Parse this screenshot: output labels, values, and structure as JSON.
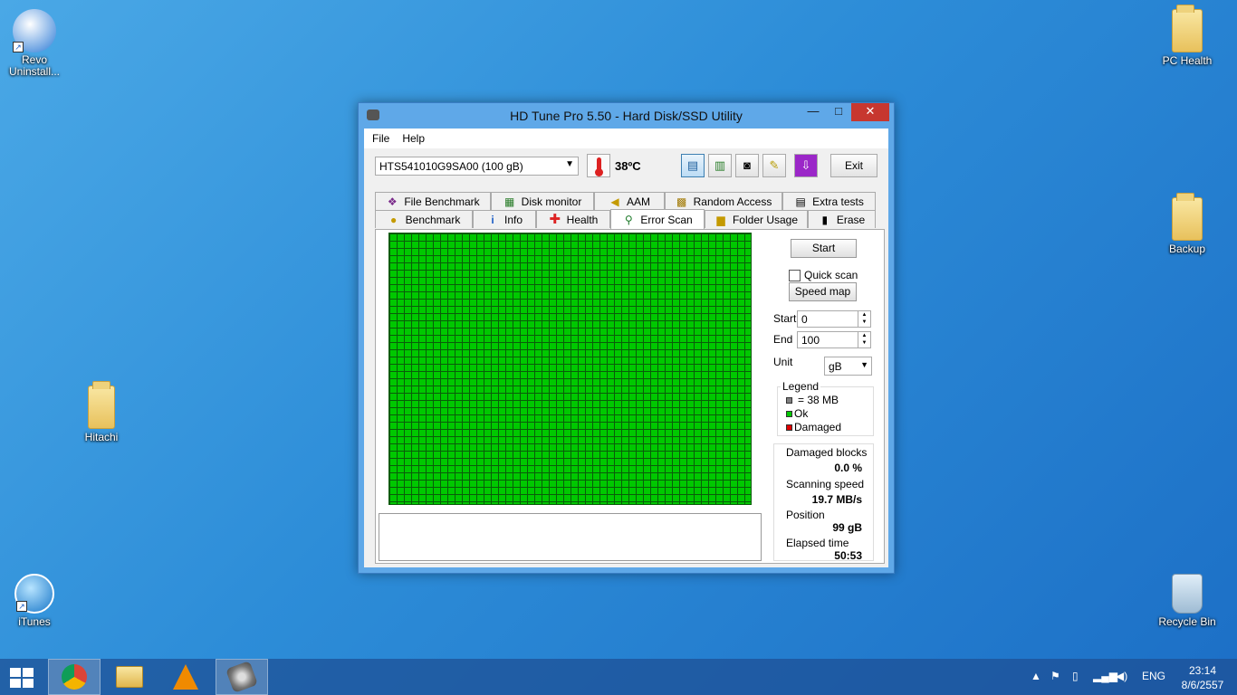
{
  "desktop": {
    "icons": [
      {
        "label": "Revo\nUninstall..."
      },
      {
        "label": "PC Health"
      },
      {
        "label": "Backup"
      },
      {
        "label": "Hitachi"
      },
      {
        "label": "iTunes"
      },
      {
        "label": "Recycle Bin"
      }
    ]
  },
  "window": {
    "title": "HD Tune Pro 5.50 - Hard Disk/SSD Utility",
    "controls": {
      "minimize": "—",
      "maximize": "□",
      "close": "✕"
    }
  },
  "menu": {
    "file": "File",
    "help": "Help"
  },
  "toolbar": {
    "drive": "HTS541010G9SA00 (100 gB)",
    "temperature": "38ºC",
    "exit": "Exit",
    "icons": [
      "copy-text-icon",
      "copy-image-icon",
      "camera-icon",
      "options-icon",
      "save-icon"
    ]
  },
  "tabs": {
    "row1": [
      "File Benchmark",
      "Disk monitor",
      "AAM",
      "Random Access",
      "Extra tests"
    ],
    "row2": [
      "Benchmark",
      "Info",
      "Health",
      "Error Scan",
      "Folder Usage",
      "Erase"
    ],
    "active": "Error Scan"
  },
  "error_scan": {
    "start_button": "Start",
    "quick_scan_label": "Quick scan",
    "quick_scan_checked": false,
    "speed_map_button": "Speed map",
    "start_label": "Start",
    "start_value": "0",
    "end_label": "End",
    "end_value": "100",
    "unit_label": "Unit",
    "unit_value": "gB",
    "legend": {
      "title": "Legend",
      "block_size": "= 38 MB",
      "ok": "Ok",
      "damaged": "Damaged"
    },
    "colors": {
      "ok": "#00c800",
      "damaged": "#e00000",
      "block": "#808080"
    },
    "stats": {
      "damaged_blocks_label": "Damaged blocks",
      "damaged_blocks_value": "0.0 %",
      "scanning_speed_label": "Scanning speed",
      "scanning_speed_value": "19.7 MB/s",
      "position_label": "Position",
      "position_value": "99 gB",
      "elapsed_label": "Elapsed time",
      "elapsed_value": "50:53"
    }
  },
  "taskbar": {
    "items": [
      "chrome-icon",
      "file-explorer-icon",
      "vlc-icon",
      "hdtune-icon"
    ],
    "language": "ENG",
    "time": "23:14",
    "date": "8/6/2557"
  }
}
